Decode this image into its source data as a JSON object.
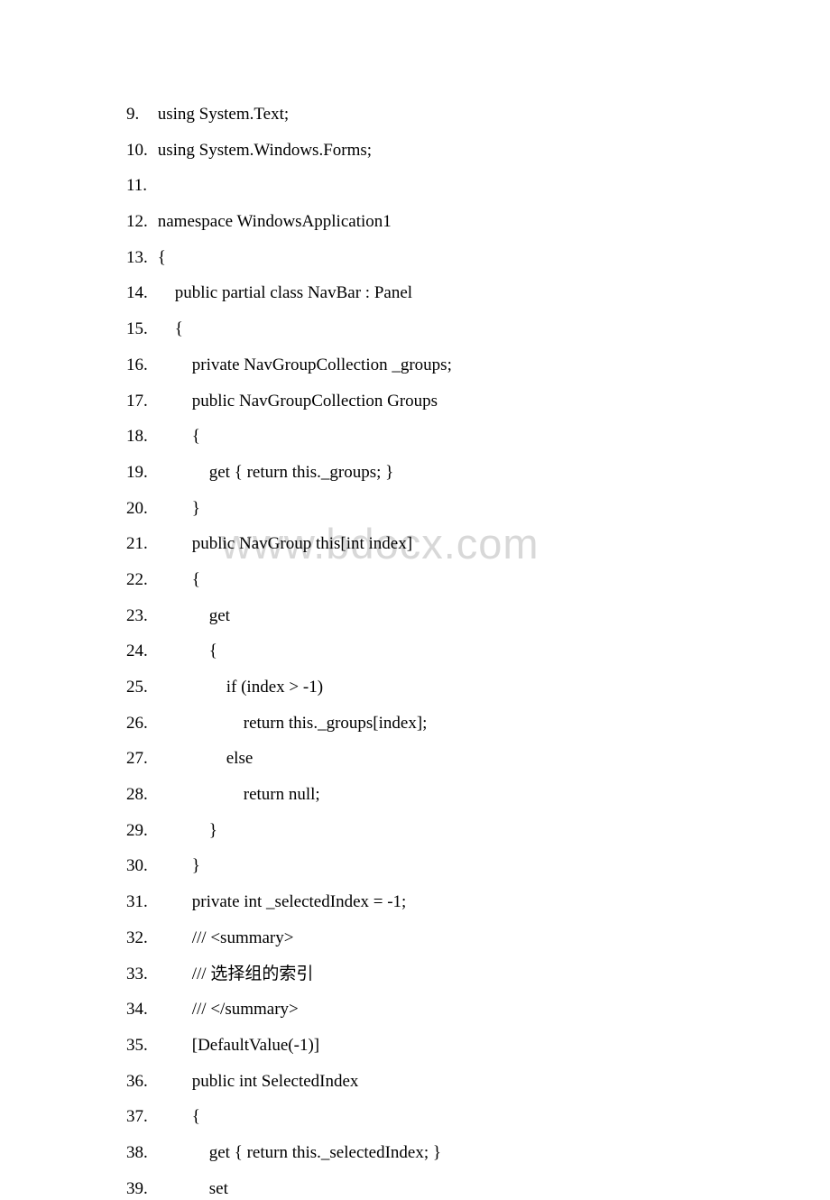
{
  "watermark": "www.bdocx.com",
  "lines": [
    {
      "num": "9.",
      "text": " using System.Text;"
    },
    {
      "num": "10.",
      "text": " using System.Windows.Forms;"
    },
    {
      "num": "11.",
      "text": ""
    },
    {
      "num": "12.",
      "text": " namespace WindowsApplication1"
    },
    {
      "num": "13.",
      "text": " {"
    },
    {
      "num": "14.",
      "text": "     public partial class NavBar : Panel"
    },
    {
      "num": "15.",
      "text": "     {"
    },
    {
      "num": "16.",
      "text": "         private NavGroupCollection _groups;"
    },
    {
      "num": "17.",
      "text": "         public NavGroupCollection Groups"
    },
    {
      "num": "18.",
      "text": "         {"
    },
    {
      "num": "19.",
      "text": "             get { return this._groups; }"
    },
    {
      "num": "20.",
      "text": "         }"
    },
    {
      "num": "21.",
      "text": "         public NavGroup this[int index]"
    },
    {
      "num": "22.",
      "text": "         {"
    },
    {
      "num": "23.",
      "text": "             get"
    },
    {
      "num": "24.",
      "text": "             {"
    },
    {
      "num": "25.",
      "text": "                 if (index > -1)"
    },
    {
      "num": "26.",
      "text": "                     return this._groups[index];"
    },
    {
      "num": "27.",
      "text": "                 else"
    },
    {
      "num": "28.",
      "text": "                     return null;"
    },
    {
      "num": "29.",
      "text": "             }"
    },
    {
      "num": "30.",
      "text": "         }"
    },
    {
      "num": "31.",
      "text": "         private int _selectedIndex = -1;"
    },
    {
      "num": "32.",
      "text": "         /// <summary>"
    },
    {
      "num": "33.",
      "text": "         /// 选择组的索引"
    },
    {
      "num": "34.",
      "text": "         /// </summary>"
    },
    {
      "num": "35.",
      "text": "         [DefaultValue(-1)]"
    },
    {
      "num": "36.",
      "text": "         public int SelectedIndex"
    },
    {
      "num": "37.",
      "text": "         {"
    },
    {
      "num": "38.",
      "text": "             get { return this._selectedIndex; }"
    },
    {
      "num": "39.",
      "text": "             set"
    }
  ]
}
